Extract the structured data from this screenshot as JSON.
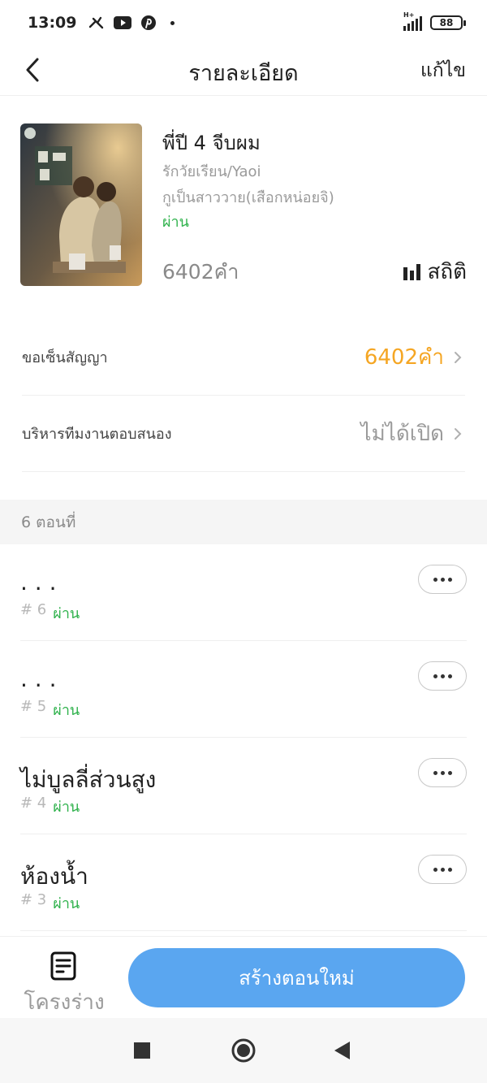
{
  "status_bar": {
    "time": "13:09",
    "network": "H+",
    "battery": "88",
    "icons": [
      "tool-icon",
      "youtube-icon",
      "pinterest-icon"
    ]
  },
  "header": {
    "title": "รายละเอียด",
    "edit_label": "แก้ไข"
  },
  "book": {
    "title": "พี่ปี 4 จีบผม",
    "category": "รักวัยเรียน/Yaoi",
    "author": "กูเป็นสาววาย(เสือกหน่อยจิ)",
    "status": "ผ่าน",
    "word_count": "6402คำ",
    "stats_label": "สถิติ"
  },
  "settings": [
    {
      "label": "ขอเซ็นสัญญา",
      "value": "6402คำ",
      "value_color": "#f5a623"
    },
    {
      "label": "บริหารทีมงานตอบสนอง",
      "value": "ไม่ได้เปิด",
      "value_color": "#9a9a9a"
    }
  ],
  "chapters_section": {
    "label": "6 ตอนที่"
  },
  "chapters": [
    {
      "title": ". . .",
      "number": "# 6",
      "status": "ผ่าน"
    },
    {
      "title": ". . .",
      "number": "# 5",
      "status": "ผ่าน"
    },
    {
      "title": "ไม่บูลลี่ส่วนสูง",
      "number": "# 4",
      "status": "ผ่าน"
    },
    {
      "title": "ห้องน้ำ",
      "number": "# 3",
      "status": "ผ่าน"
    }
  ],
  "bottom_bar": {
    "draft_label": "โครงร่าง",
    "create_label": "สร้างตอนใหม่"
  },
  "colors": {
    "accent_blue": "#5aa6f0",
    "success_green": "#2fb24c",
    "warning_orange": "#f5a623"
  }
}
